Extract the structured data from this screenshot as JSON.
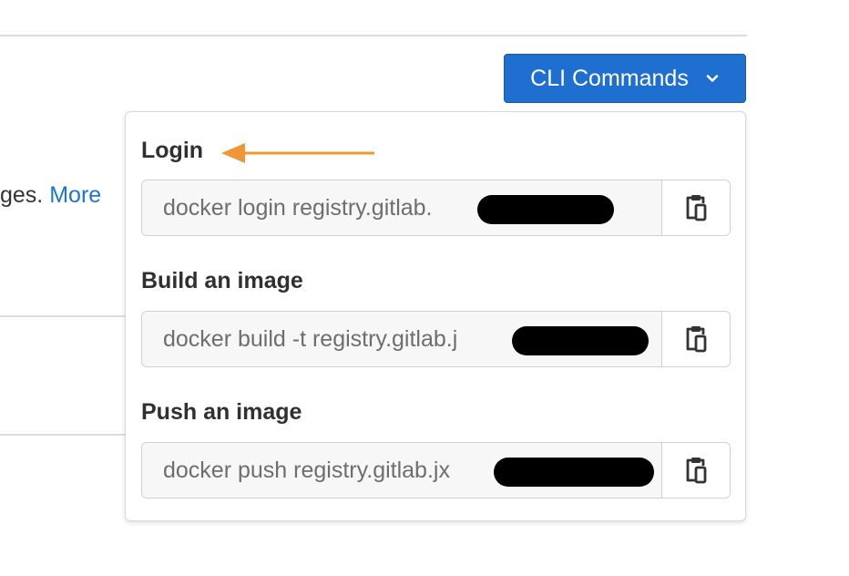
{
  "background": {
    "text_prefix": "ges.",
    "more_link": "More"
  },
  "cli_button": {
    "label": "CLI Commands",
    "icon": "chevron-down-icon",
    "color": "#1f6fd1"
  },
  "dropdown": {
    "sections": [
      {
        "label": "Login",
        "command": "docker login registry.gitlab.",
        "copy_icon": "clipboard-icon"
      },
      {
        "label": "Build an image",
        "command": "docker build -t registry.gitlab.j",
        "copy_icon": "clipboard-icon"
      },
      {
        "label": "Push an image",
        "command": "docker push registry.gitlab.jx",
        "copy_icon": "clipboard-icon"
      }
    ],
    "annotation_arrow_color": "#ef9734"
  }
}
